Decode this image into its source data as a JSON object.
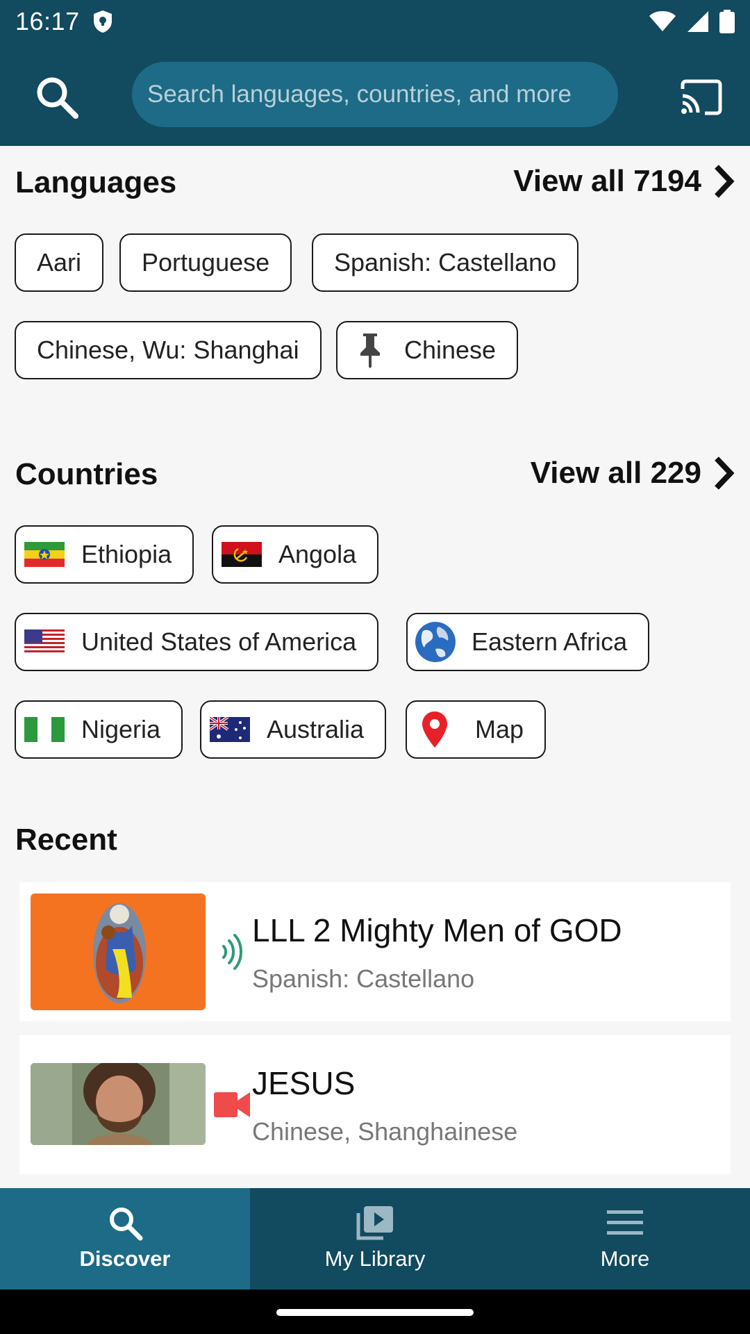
{
  "status_bar": {
    "time": "16:17"
  },
  "search": {
    "placeholder": "Search languages, countries, and more"
  },
  "languages": {
    "title": "Languages",
    "view_all": "View all 7194",
    "chips": [
      "Aari",
      "Portuguese",
      "Spanish: Castellano",
      "Chinese, Wu: Shanghai",
      "Chinese"
    ]
  },
  "countries": {
    "title": "Countries",
    "view_all": "View all 229",
    "chips": [
      "Ethiopia",
      "Angola",
      "United States of America",
      "Eastern Africa",
      "Nigeria",
      "Australia",
      "Map"
    ]
  },
  "recent": {
    "title": "Recent",
    "items": [
      {
        "title": "LLL 2 Mighty Men of GOD",
        "subtitle": "Spanish: Castellano",
        "media": "audio-icon"
      },
      {
        "title": "JESUS",
        "subtitle": "Chinese, Shanghainese",
        "media": "video-icon"
      }
    ]
  },
  "bottom_nav": {
    "items": [
      {
        "label": "Discover",
        "icon": "search-icon",
        "active": true
      },
      {
        "label": "My Library",
        "icon": "library-icon",
        "active": false
      },
      {
        "label": "More",
        "icon": "menu-icon",
        "active": false
      }
    ]
  },
  "colors": {
    "header_bg": "#124a5f",
    "search_bg": "#1d6b86",
    "active_tab_bg": "#1d6b86",
    "audio_icon": "#2e9a7a",
    "video_icon": "#ef4b4b",
    "map_pin": "#e8202a"
  }
}
